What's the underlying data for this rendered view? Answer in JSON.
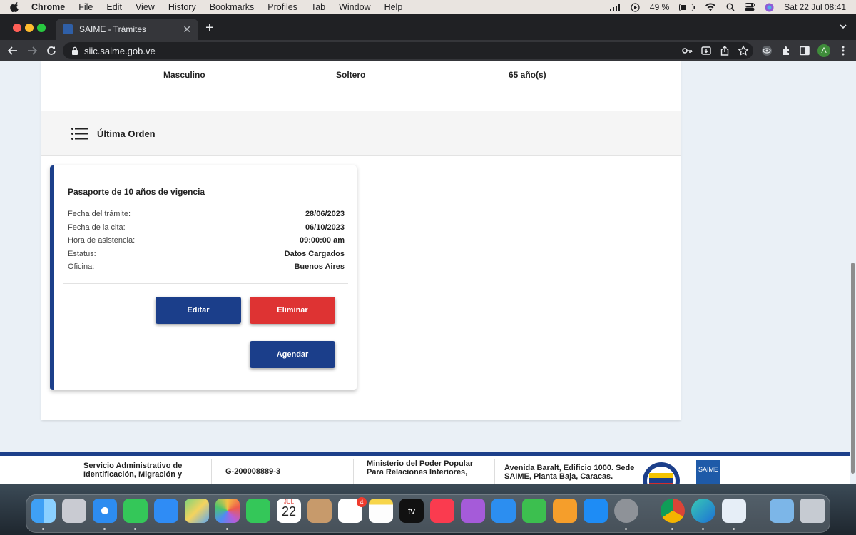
{
  "menubar": {
    "app": "Chrome",
    "items": [
      "File",
      "Edit",
      "View",
      "History",
      "Bookmarks",
      "Profiles",
      "Tab",
      "Window",
      "Help"
    ],
    "battery": "49 %",
    "datetime": "Sat 22 Jul  08:41"
  },
  "browser": {
    "tab_title": "SAIME - Trámites",
    "new_tab": "+",
    "url": "siic.saime.gob.ve",
    "profile_initial": "A"
  },
  "profile_info": {
    "sexo": "Masculino",
    "estado_civil": "Soltero",
    "edad": "65 año(s)"
  },
  "order_section": {
    "title": "Última Orden"
  },
  "order_card": {
    "title": "Pasaporte de 10 años de vigencia",
    "rows": [
      {
        "label": "Fecha del trámite:",
        "value": "28/06/2023"
      },
      {
        "label": "Fecha de la cita:",
        "value": "06/10/2023"
      },
      {
        "label": "Hora de asistencia:",
        "value": "09:00:00 am"
      },
      {
        "label": "Estatus:",
        "value": "Datos Cargados"
      },
      {
        "label": "Oficina:",
        "value": "Buenos Aires"
      }
    ],
    "buttons": {
      "edit": "Editar",
      "delete": "Eliminar",
      "schedule": "Agendar"
    }
  },
  "footer": {
    "org_line1": "Servicio Administrativo de",
    "org_line2": "Identificación, Migración y",
    "rif": "G-200008889-3",
    "ministry_line1": "Ministerio del Poder Popular",
    "ministry_line2": "Para Relaciones Interiores,",
    "address_line1": "Avenida Baralt, Edificio 1000. Sede",
    "address_line2": "SAIME, Planta Baja, Caracas.",
    "logo_text": "SAIME"
  },
  "dock": {
    "calendar_month": "JUL",
    "calendar_day": "22",
    "reminders_badge": "4",
    "tv_label": "tv",
    "icons": [
      "finder-icon",
      "launchpad-icon",
      "safari-icon",
      "messages-icon",
      "mail-icon",
      "maps-icon",
      "photos-icon",
      "facetime-icon",
      "calendar-icon",
      "contacts-icon",
      "reminders-icon",
      "notes-icon",
      "apple-tv-icon",
      "music-icon",
      "podcasts-icon",
      "keynote-icon",
      "numbers-icon",
      "pages-icon",
      "app-store-icon",
      "system-settings-icon",
      "chrome-icon",
      "edge-icon",
      "preview-icon",
      "downloads-folder-icon",
      "trash-icon"
    ]
  },
  "colors": {
    "primary_blue": "#1b3e8a",
    "danger_red": "#de3333",
    "page_bg": "#eaf0f6"
  }
}
